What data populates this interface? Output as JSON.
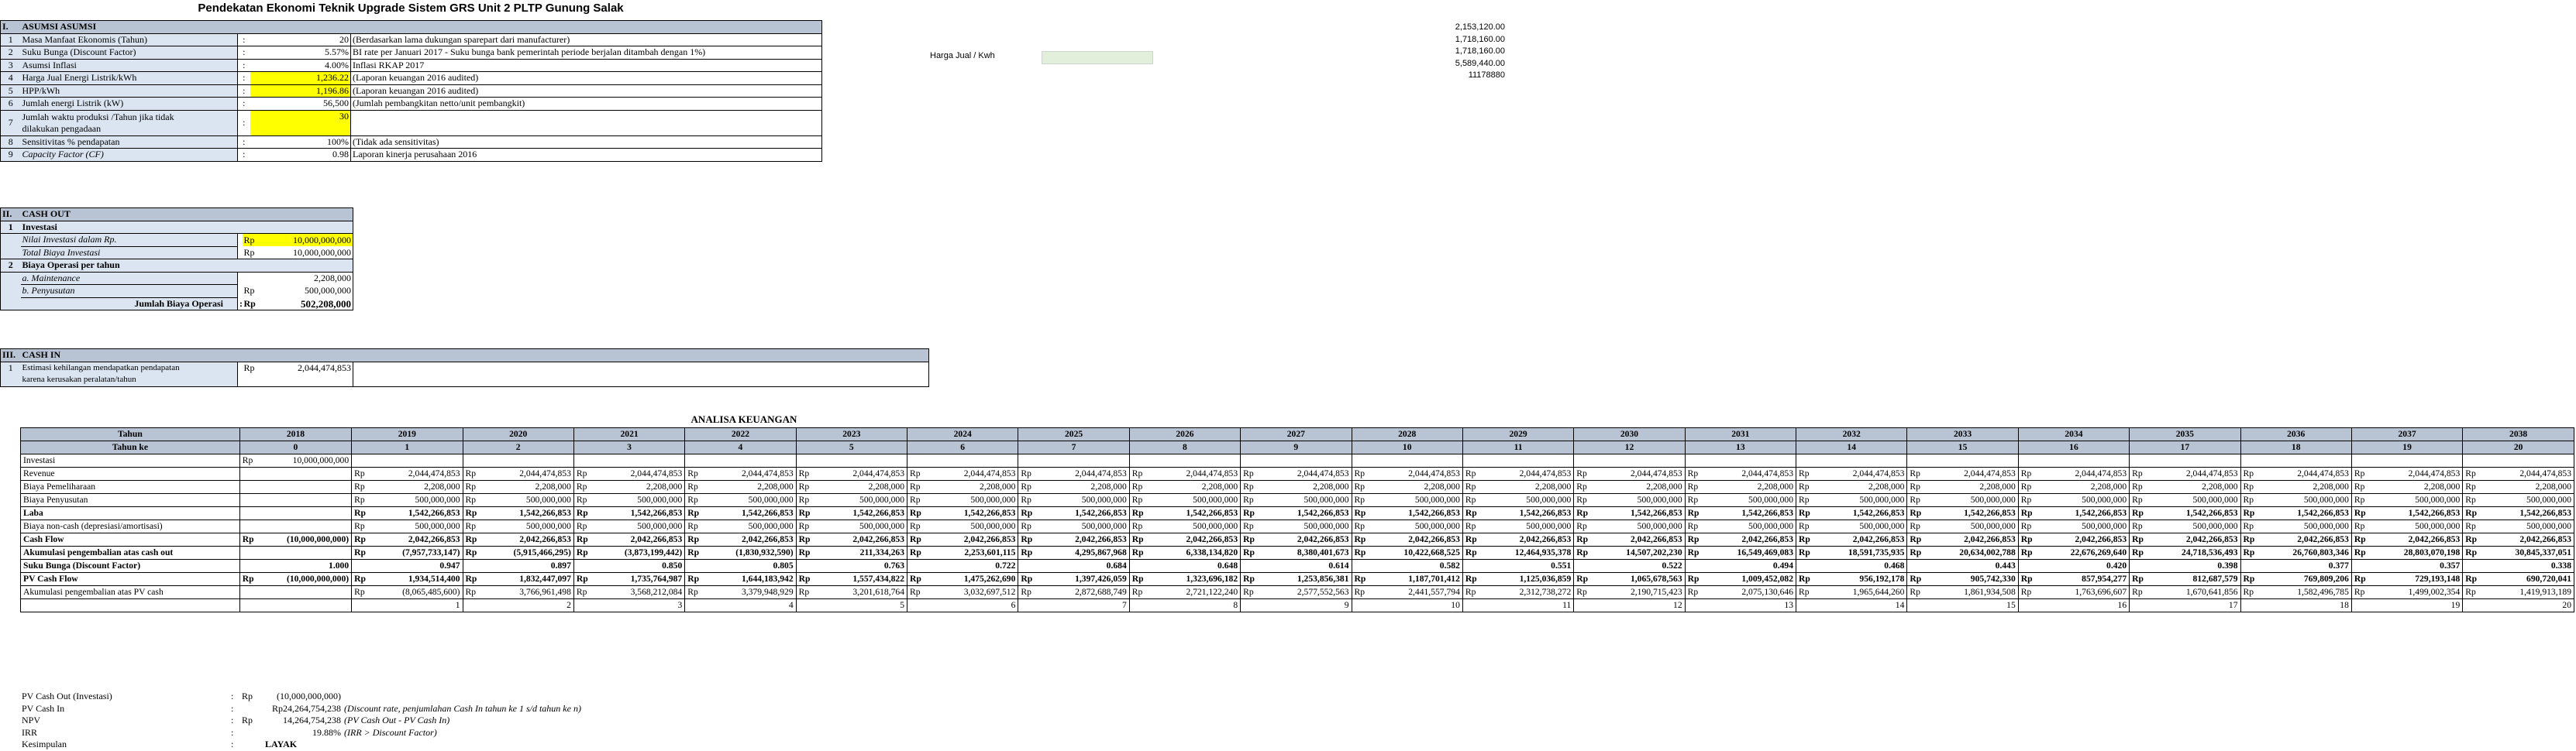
{
  "title": "Pendekatan Ekonomi Teknik Upgrade Sistem GRS Unit 2 PLTP Gunung Salak",
  "asumsi": {
    "num": "I.",
    "header": "ASUMSI ASUMSI",
    "rows": [
      {
        "n": "1",
        "label": "Masa Manfaat Ekonomis (Tahun)",
        "sep": ":",
        "value": "20",
        "note": "(Berdasarkan lama dukungan sparepart dari manufacturer)"
      },
      {
        "n": "2",
        "label": "Suku Bunga (Discount Factor)",
        "sep": ":",
        "value": "5.57%",
        "note": "BI rate per Januari 2017 - Suku bunga bank pemerintah periode berjalan ditambah dengan 1%)"
      },
      {
        "n": "3",
        "label": "Asumsi Inflasi",
        "sep": ":",
        "value": "4.00%",
        "note": "Inflasi RKAP 2017"
      },
      {
        "n": "4",
        "label": "Harga Jual Energi Listrik/kWh",
        "sep": ":",
        "value": "1,236.22",
        "note": "(Laporan keuangan 2016 audited)"
      },
      {
        "n": "5",
        "label": "HPP/kWh",
        "sep": ":",
        "value": "1,196.86",
        "note": "(Laporan keuangan 2016 audited)"
      },
      {
        "n": "6",
        "label": "Jumlah energi Listrik (kW)",
        "sep": ":",
        "value": "56,500",
        "note": "(Jumlah pembangkitan netto/unit pembangkit)"
      },
      {
        "n": "7",
        "label": "Jumlah waktu produksi /Tahun jika tidak",
        "label2": "dilakukan pengadaan",
        "sep": ":",
        "value": "30",
        "note": ""
      },
      {
        "n": "8",
        "label": "Sensitivitas % pendapatan",
        "sep": ":",
        "value": "100%",
        "note": "(Tidak ada sensitivitas)"
      },
      {
        "n": "9",
        "label": "Capacity Factor (CF)",
        "sep": ":",
        "value": "0.98",
        "note": "Laporan kinerja perusahaan 2016"
      }
    ]
  },
  "side": {
    "harga_label": "Harga Jual / Kwh",
    "values": [
      "2,153,120.00",
      "1,718,160.00",
      "1,718,160.00",
      "5,589,440.00",
      "11178880"
    ]
  },
  "cashout": {
    "num": "II.",
    "header": "CASH OUT",
    "inv_n": "1",
    "inv_label": "Investasi",
    "nilai_label": "Nilai Investasi dalam Rp.",
    "nilai_value": "10,000,000,000",
    "total_label": "Total Biaya Investasi",
    "total_value": "10,000,000,000",
    "op_n": "2",
    "op_label": "Biaya Operasi per tahun",
    "maint_label": "a. Maintenance",
    "maint_value": "2,208,000",
    "peny_label": "b. Penyusutan",
    "peny_value": "500,000,000",
    "jumlah_label": "Jumlah Biaya Operasi",
    "jumlah_value": "502,208,000",
    "rp": "Rp"
  },
  "cashin": {
    "num": "III.",
    "header": "CASH IN",
    "n": "1",
    "label": "Estimasi kehilangan mendapatkan pendapatan",
    "label2": "karena kerusakan peralatan/tahun",
    "rp": "Rp",
    "value": "2,044,474,853"
  },
  "analisa": {
    "title": "ANALISA KEUANGAN",
    "tahun_label": "Tahun",
    "tahunke_label": "Tahun ke",
    "years": [
      "2018",
      "2019",
      "2020",
      "2021",
      "2022",
      "2023",
      "2024",
      "2025",
      "2026",
      "2027",
      "2028",
      "2029",
      "2030",
      "2031",
      "2032",
      "2033",
      "2034",
      "2035",
      "2036",
      "2037",
      "2038"
    ],
    "idx": [
      "0",
      "1",
      "2",
      "3",
      "4",
      "5",
      "6",
      "7",
      "8",
      "9",
      "10",
      "11",
      "12",
      "13",
      "14",
      "15",
      "16",
      "17",
      "18",
      "19",
      "20"
    ],
    "rows": [
      {
        "label": "Investasi",
        "bold": false,
        "y0": "10,000,000,000",
        "rp0": "Rp",
        "vals": []
      },
      {
        "label": "Revenue",
        "bold": false,
        "y0": "",
        "rp0": "",
        "vals": [
          "2,044,474,853",
          "2,044,474,853",
          "2,044,474,853",
          "2,044,474,853",
          "2,044,474,853",
          "2,044,474,853",
          "2,044,474,853",
          "2,044,474,853",
          "2,044,474,853",
          "2,044,474,853",
          "2,044,474,853",
          "2,044,474,853",
          "2,044,474,853",
          "2,044,474,853",
          "2,044,474,853",
          "2,044,474,853",
          "2,044,474,853",
          "2,044,474,853",
          "2,044,474,853",
          "2,044,474,853"
        ]
      },
      {
        "label": "Biaya Pemeliharaan",
        "bold": false,
        "y0": "",
        "rp0": "",
        "vals": [
          "2,208,000",
          "2,208,000",
          "2,208,000",
          "2,208,000",
          "2,208,000",
          "2,208,000",
          "2,208,000",
          "2,208,000",
          "2,208,000",
          "2,208,000",
          "2,208,000",
          "2,208,000",
          "2,208,000",
          "2,208,000",
          "2,208,000",
          "2,208,000",
          "2,208,000",
          "2,208,000",
          "2,208,000",
          "2,208,000"
        ]
      },
      {
        "label": "Biaya Penyusutan",
        "bold": false,
        "y0": "",
        "rp0": "",
        "vals": [
          "500,000,000",
          "500,000,000",
          "500,000,000",
          "500,000,000",
          "500,000,000",
          "500,000,000",
          "500,000,000",
          "500,000,000",
          "500,000,000",
          "500,000,000",
          "500,000,000",
          "500,000,000",
          "500,000,000",
          "500,000,000",
          "500,000,000",
          "500,000,000",
          "500,000,000",
          "500,000,000",
          "500,000,000",
          "500,000,000"
        ]
      },
      {
        "label": "Laba",
        "bold": true,
        "y0": "",
        "rp0": "",
        "vals": [
          "1,542,266,853",
          "1,542,266,853",
          "1,542,266,853",
          "1,542,266,853",
          "1,542,266,853",
          "1,542,266,853",
          "1,542,266,853",
          "1,542,266,853",
          "1,542,266,853",
          "1,542,266,853",
          "1,542,266,853",
          "1,542,266,853",
          "1,542,266,853",
          "1,542,266,853",
          "1,542,266,853",
          "1,542,266,853",
          "1,542,266,853",
          "1,542,266,853",
          "1,542,266,853",
          "1,542,266,853"
        ]
      },
      {
        "label": "Biaya non-cash (depresiasi/amortisasi)",
        "bold": false,
        "y0": "",
        "rp0": "",
        "vals": [
          "500,000,000",
          "500,000,000",
          "500,000,000",
          "500,000,000",
          "500,000,000",
          "500,000,000",
          "500,000,000",
          "500,000,000",
          "500,000,000",
          "500,000,000",
          "500,000,000",
          "500,000,000",
          "500,000,000",
          "500,000,000",
          "500,000,000",
          "500,000,000",
          "500,000,000",
          "500,000,000",
          "500,000,000",
          "500,000,000"
        ]
      },
      {
        "label": "Cash Flow",
        "bold": true,
        "y0": "(10,000,000,000)",
        "rp0": "Rp",
        "vals": [
          "2,042,266,853",
          "2,042,266,853",
          "2,042,266,853",
          "2,042,266,853",
          "2,042,266,853",
          "2,042,266,853",
          "2,042,266,853",
          "2,042,266,853",
          "2,042,266,853",
          "2,042,266,853",
          "2,042,266,853",
          "2,042,266,853",
          "2,042,266,853",
          "2,042,266,853",
          "2,042,266,853",
          "2,042,266,853",
          "2,042,266,853",
          "2,042,266,853",
          "2,042,266,853",
          "2,042,266,853"
        ]
      },
      {
        "label": "Akumulasi pengembalian atas cash out",
        "bold": true,
        "y0": "",
        "rp0": "",
        "vals": [
          "(7,957,733,147)",
          "(5,915,466,295)",
          "(3,873,199,442)",
          "(1,830,932,590)",
          "211,334,263",
          "2,253,601,115",
          "4,295,867,968",
          "6,338,134,820",
          "8,380,401,673",
          "10,422,668,525",
          "12,464,935,378",
          "14,507,202,230",
          "16,549,469,083",
          "18,591,735,935",
          "20,634,002,788",
          "22,676,269,640",
          "24,718,536,493",
          "26,760,803,346",
          "28,803,070,198",
          "30,845,337,051"
        ]
      },
      {
        "label": "Suku Bunga (Discount Factor)",
        "bold": true,
        "y0": "1.000",
        "rp0": "",
        "noRp": true,
        "vals": [
          "0.947",
          "0.897",
          "0.850",
          "0.805",
          "0.763",
          "0.722",
          "0.684",
          "0.648",
          "0.614",
          "0.582",
          "0.551",
          "0.522",
          "0.494",
          "0.468",
          "0.443",
          "0.420",
          "0.398",
          "0.377",
          "0.357",
          "0.338"
        ]
      },
      {
        "label": "PV Cash Flow",
        "bold": true,
        "y0": "(10,000,000,000)",
        "rp0": "Rp",
        "vals": [
          "1,934,514,400",
          "1,832,447,097",
          "1,735,764,987",
          "1,644,183,942",
          "1,557,434,822",
          "1,475,262,690",
          "1,397,426,059",
          "1,323,696,182",
          "1,253,856,381",
          "1,187,701,412",
          "1,125,036,859",
          "1,065,678,563",
          "1,009,452,082",
          "956,192,178",
          "905,742,330",
          "857,954,277",
          "812,687,579",
          "769,809,206",
          "729,193,148",
          "690,720,041"
        ]
      },
      {
        "label": "Akumulasi pengembalian atas PV cash",
        "bold": false,
        "y0": "",
        "rp0": "",
        "vals": [
          "(8,065,485,600)",
          "3,766,961,498",
          "3,568,212,084",
          "3,379,948,929",
          "3,201,618,764",
          "3,032,697,512",
          "2,872,688,749",
          "2,721,122,240",
          "2,577,552,563",
          "2,441,557,794",
          "2,312,738,272",
          "2,190,715,423",
          "2,075,130,646",
          "1,965,644,260",
          "1,861,934,508",
          "1,763,696,607",
          "1,670,641,856",
          "1,582,496,785",
          "1,499,002,354",
          "1,419,913,189"
        ]
      }
    ],
    "bottom_idx": [
      "1",
      "2",
      "3",
      "4",
      "5",
      "6",
      "7",
      "8",
      "9",
      "10",
      "11",
      "12",
      "13",
      "14",
      "15",
      "16",
      "17",
      "18",
      "19",
      "20"
    ]
  },
  "summary": {
    "rows": [
      {
        "label": "PV Cash Out (Investasi)",
        "sep": ":",
        "rp": "Rp",
        "value": "(10,000,000,000)",
        "note": ""
      },
      {
        "label": "PV Cash In",
        "sep": ":",
        "rp": "",
        "value": "Rp24,264,754,238",
        "note": "(Discount rate, penjumlahan Cash In tahun ke 1 s/d tahun ke n)"
      },
      {
        "label": "NPV",
        "sep": ":",
        "rp": "Rp",
        "value": "14,264,754,238",
        "note": "(PV Cash Out - PV Cash In)"
      },
      {
        "label": "IRR",
        "sep": ":",
        "rp": "",
        "value": "19.88%",
        "note": "(IRR > Discount Factor)"
      },
      {
        "label": "Kesimpulan",
        "sep": ":",
        "rp": "",
        "value": "LAYAK",
        "note": ""
      }
    ]
  }
}
